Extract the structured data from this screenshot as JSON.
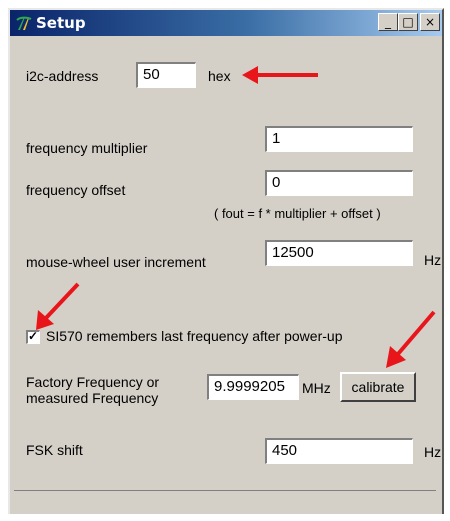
{
  "window": {
    "title": "Setup",
    "minimize": "_",
    "maximize": "□",
    "close": "×"
  },
  "i2c": {
    "label": "i2c-address",
    "value": "50",
    "unit": "hex"
  },
  "multiplier": {
    "label": "frequency multiplier",
    "value": "1"
  },
  "offset": {
    "label": "frequency offset",
    "value": "0"
  },
  "formula": "( fout = f * multiplier + offset )",
  "increment": {
    "label": "mouse-wheel user increment",
    "value": "12500",
    "unit": "Hz"
  },
  "remember": {
    "label": "SI570 remembers last frequency after power-up",
    "checked": "✓"
  },
  "factory": {
    "label_line1": "Factory Frequency  or",
    "label_line2": "measured Frequency",
    "value": "9.9999205",
    "unit": "MHz",
    "button": "calibrate"
  },
  "fsk": {
    "label": "FSK shift",
    "value": "450",
    "unit": "Hz"
  },
  "colors": {
    "arrow": "#e8161b",
    "titlebar": "#0a246a"
  },
  "icons": {
    "app": "tuning-fork-icon",
    "annotation": "red-arrow-icon"
  }
}
